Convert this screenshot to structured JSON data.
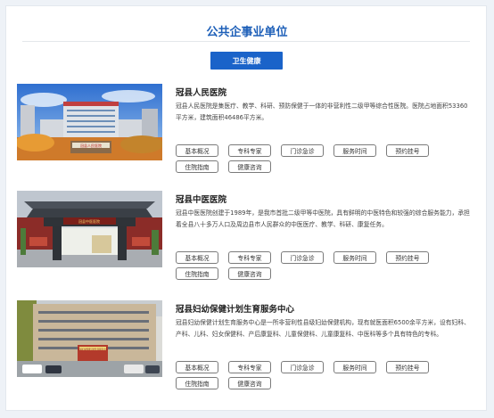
{
  "page": {
    "title": "公共企事业单位",
    "active_tab": "卫生健康",
    "colors": {
      "accent": "#1a63c9",
      "title": "#1d5fb8",
      "background": "#eef2f7"
    }
  },
  "entries": [
    {
      "name": "冠县人民医院",
      "description": "冠县人民医院是集医疗、教学、科研、预防保健于一体的非营利性二级甲等综合性医院。医院占地面积53360平方米，建筑面积46486平方米。",
      "photo_sign": "冠县人民医院",
      "buttons": [
        "基本概况",
        "专科专家",
        "门诊急诊",
        "服务时间",
        "预约挂号",
        "住院指南",
        "健康咨询"
      ]
    },
    {
      "name": "冠县中医医院",
      "description": "冠县中医医院创建于1989年，是我市首批二级甲等中医院，具有鲜明的中医特色和较强的综合服务能力，承担着全县八十多万人口及周边县市人民群众的中医医疗、教学、科研、康复任务。",
      "photo_sign": "冠县中医医院",
      "buttons": [
        "基本概况",
        "专科专家",
        "门诊急诊",
        "服务时间",
        "预约挂号",
        "住院指南",
        "健康咨询"
      ]
    },
    {
      "name": "冠县妇幼保健计划生育服务中心",
      "description": "冠县妇幼保健计划生育服务中心是一所非营利性县级妇幼保健机构，现有就医面积6500余平方米，设有妇科、产科、儿科、妇女保健科、产后康复科、儿童保健科、儿童康复科、中医科等多个具有特色的专科。",
      "photo_sign": "冠县妇幼保健计划生育服务中心",
      "buttons": [
        "基本概况",
        "专科专家",
        "门诊急诊",
        "服务时间",
        "预约挂号",
        "住院指南",
        "健康咨询"
      ]
    }
  ]
}
